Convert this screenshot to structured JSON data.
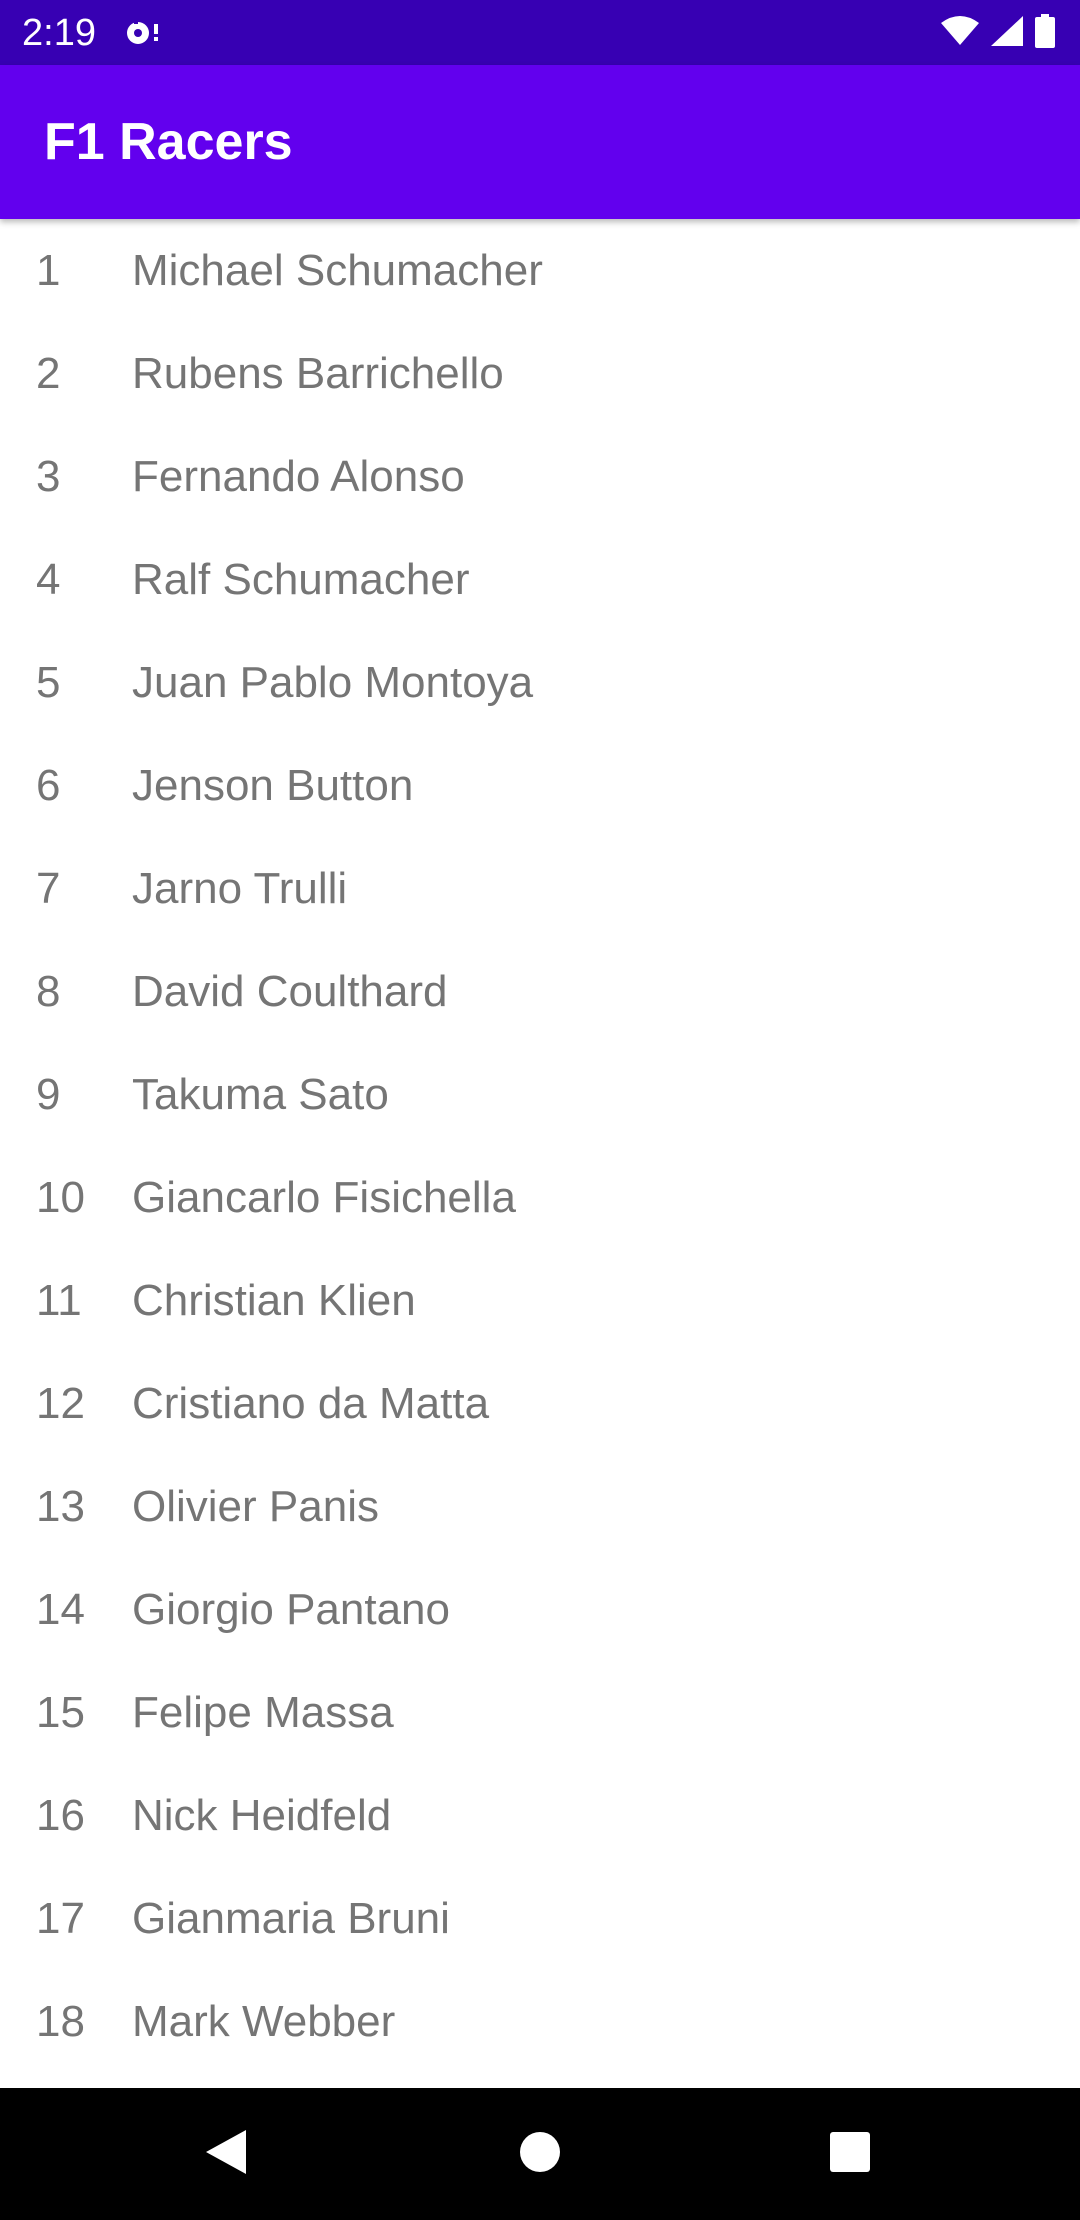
{
  "status_bar": {
    "time": "2:19",
    "icons": [
      "notification-icon",
      "wifi-icon",
      "signal-icon",
      "battery-icon"
    ]
  },
  "app_bar": {
    "title": "F1 Racers",
    "color": "#6200ee"
  },
  "colors": {
    "status_bar": "#3700b3",
    "app_bar": "#6200ee",
    "list_text": "#757575",
    "nav_bar": "#000000"
  },
  "racers": [
    {
      "number": "1",
      "name": "Michael Schumacher"
    },
    {
      "number": "2",
      "name": "Rubens Barrichello"
    },
    {
      "number": "3",
      "name": "Fernando Alonso"
    },
    {
      "number": "4",
      "name": "Ralf Schumacher"
    },
    {
      "number": "5",
      "name": "Juan Pablo Montoya"
    },
    {
      "number": "6",
      "name": "Jenson Button"
    },
    {
      "number": "7",
      "name": "Jarno Trulli"
    },
    {
      "number": "8",
      "name": "David Coulthard"
    },
    {
      "number": "9",
      "name": "Takuma Sato"
    },
    {
      "number": "10",
      "name": "Giancarlo Fisichella"
    },
    {
      "number": "11",
      "name": "Christian Klien"
    },
    {
      "number": "12",
      "name": "Cristiano da Matta"
    },
    {
      "number": "13",
      "name": "Olivier Panis"
    },
    {
      "number": "14",
      "name": "Giorgio Pantano"
    },
    {
      "number": "15",
      "name": "Felipe Massa"
    },
    {
      "number": "16",
      "name": "Nick Heidfeld"
    },
    {
      "number": "17",
      "name": "Gianmaria Bruni"
    },
    {
      "number": "18",
      "name": "Mark Webber"
    }
  ],
  "nav_bar": {
    "buttons": [
      "back-icon",
      "home-icon",
      "recents-icon"
    ]
  }
}
